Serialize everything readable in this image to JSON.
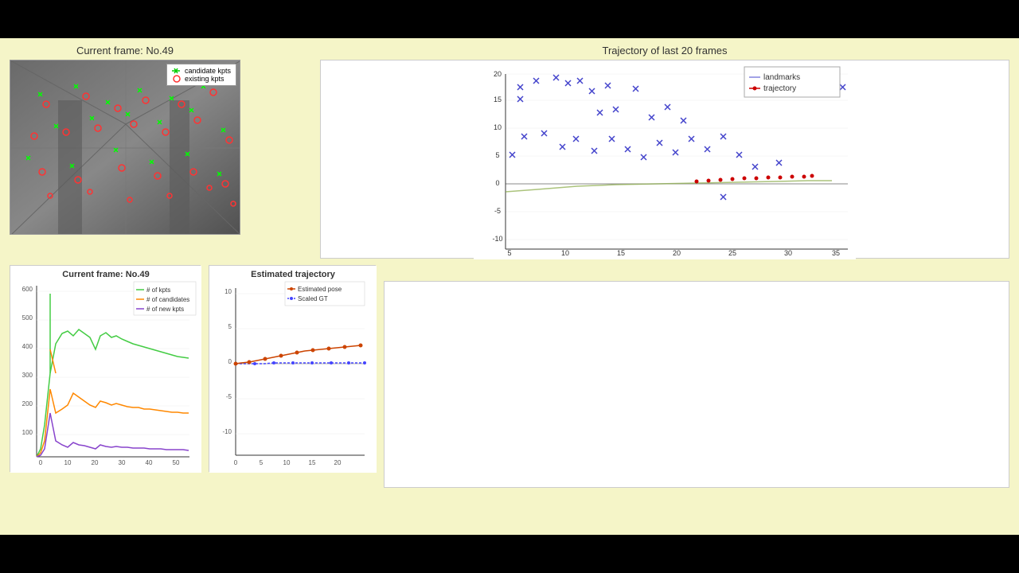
{
  "topBars": {
    "topHeight": 48,
    "bottomHeight": 48
  },
  "cameraPanel": {
    "title": "Current frame: No.49",
    "legend": {
      "candidateKpts": "candidate kpts",
      "existingKpts": "existing kpts"
    }
  },
  "trajectoryPanel": {
    "title": "Trajectory of last 20 frames",
    "legend": {
      "landmarks": "landmarks",
      "trajectory": "trajectory"
    }
  },
  "kptsPanel": {
    "title": "Current frame: No.49",
    "legend": {
      "numKpts": "# of kpts",
      "numCandidates": "# of candidates",
      "numNewKpts": "# of new kpts"
    },
    "yMax": 600,
    "xMax": 50
  },
  "estTrajPanel": {
    "title": "Estimated trajectory",
    "legend": {
      "estimatedPose": "Estimated pose",
      "scaledGT": "Scaled GT"
    },
    "yRange": [
      -10,
      10
    ],
    "xMax": 21
  }
}
